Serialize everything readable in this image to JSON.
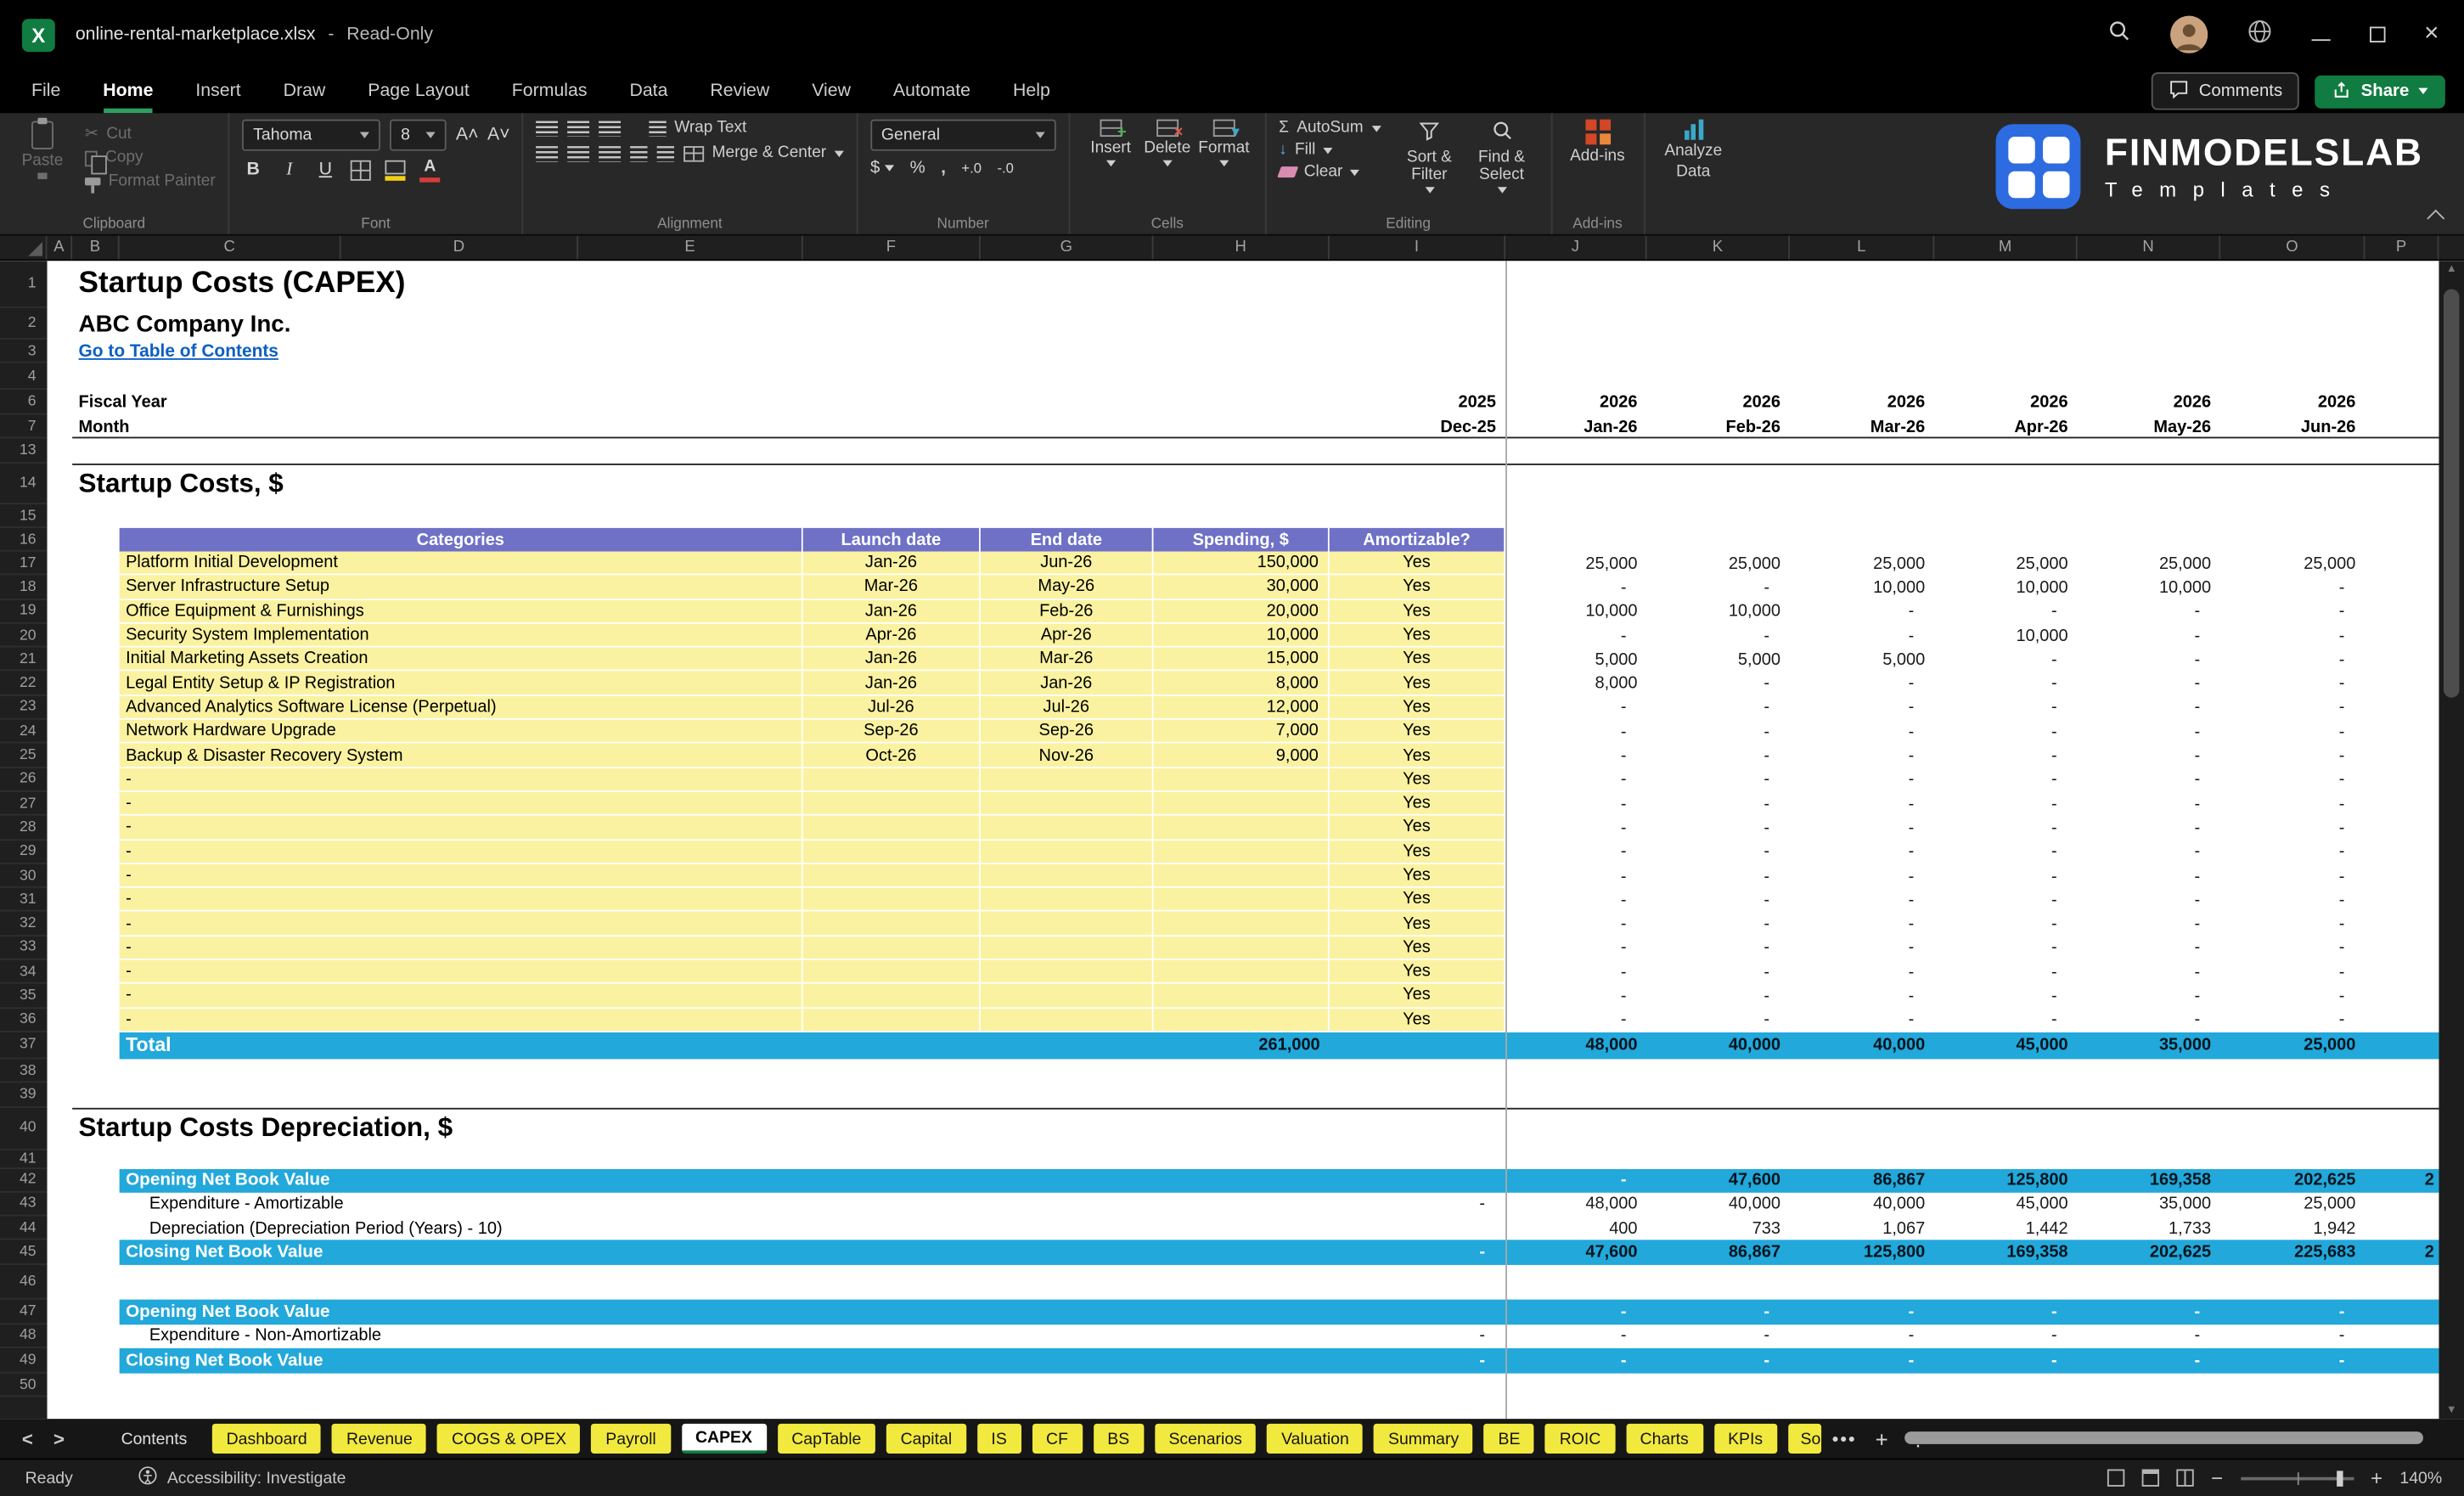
{
  "colors": {
    "accent_green": "#107C41",
    "tab_yellow": "#F2E93E",
    "cell_yellow": "#FAF2A0",
    "header_purple": "#6E71C6",
    "band_cyan": "#22A8DA",
    "link_blue": "#0D5FC3",
    "brand_blue": "#2D6BE0"
  },
  "titlebar": {
    "filename": "online-rental-marketplace.xlsx",
    "separator": "-",
    "mode": "Read-Only"
  },
  "menubar": {
    "items": [
      "File",
      "Home",
      "Insert",
      "Draw",
      "Page Layout",
      "Formulas",
      "Data",
      "Review",
      "View",
      "Automate",
      "Help"
    ],
    "active": "Home",
    "comments": "Comments",
    "share": "Share"
  },
  "ribbon": {
    "clipboard": {
      "paste": "Paste",
      "cut": "Cut",
      "copy": "Copy",
      "format_painter": "Format Painter",
      "group": "Clipboard"
    },
    "font": {
      "family": "Tahoma",
      "size": "8",
      "bold": "B",
      "italic": "I",
      "underline": "U",
      "group": "Font"
    },
    "alignment": {
      "wrap": "Wrap Text",
      "merge": "Merge & Center",
      "group": "Alignment"
    },
    "number": {
      "format": "General",
      "currency": "$",
      "percent": "%",
      "comma": ",",
      "inc_dec": "+.0",
      "dec_dec": "-.0",
      "group": "Number"
    },
    "cells": {
      "insert": "Insert",
      "delete": "Delete",
      "format": "Format",
      "group": "Cells"
    },
    "editing": {
      "autosum": "AutoSum",
      "fill": "Fill",
      "clear": "Clear",
      "sort": "Sort & Filter",
      "find": "Find & Select",
      "group": "Editing"
    },
    "addins": {
      "label": "Add-ins",
      "analyze_1": "Analyze",
      "analyze_2": "Data",
      "group": "Add-ins"
    }
  },
  "brand": {
    "name": "FINMODELSLAB",
    "tagline": "Templates"
  },
  "grid": {
    "col_letters": [
      "A",
      "B",
      "C",
      "D",
      "E",
      "F",
      "G",
      "H",
      "I",
      "J",
      "K",
      "L",
      "M",
      "N",
      "O",
      "P"
    ],
    "row_numbers": [
      1,
      2,
      3,
      4,
      6,
      7,
      13,
      14,
      15,
      16,
      17,
      18,
      19,
      20,
      21,
      22,
      23,
      24,
      25,
      26,
      27,
      28,
      29,
      30,
      31,
      32,
      33,
      34,
      35,
      36,
      37,
      38,
      39,
      40,
      41,
      42,
      43,
      44,
      45,
      46,
      47,
      48,
      49,
      50
    ]
  },
  "sheet": {
    "title": "Startup Costs (CAPEX)",
    "company": "ABC Company Inc.",
    "toc_link": "Go to Table of Contents",
    "fiscal_year_label": "Fiscal Year",
    "month_label": "Month",
    "years": [
      "2025",
      "2026",
      "2026",
      "2026",
      "2026",
      "2026",
      "2026"
    ],
    "months": [
      "Dec-25",
      "Jan-26",
      "Feb-26",
      "Mar-26",
      "Apr-26",
      "May-26",
      "Jun-26"
    ],
    "section1": "Startup Costs, $",
    "section2": "Startup Costs Depreciation, $",
    "table": {
      "headers": [
        "Categories",
        "Launch date",
        "End date",
        "Spending, $",
        "Amortizable?"
      ],
      "rows": [
        {
          "category": "Platform Initial Development",
          "launch": "Jan-26",
          "end": "Jun-26",
          "spending": "150,000",
          "amortizable": "Yes",
          "monthly": [
            "25,000",
            "25,000",
            "25,000",
            "25,000",
            "25,000",
            "25,000"
          ]
        },
        {
          "category": "Server Infrastructure Setup",
          "launch": "Mar-26",
          "end": "May-26",
          "spending": "30,000",
          "amortizable": "Yes",
          "monthly": [
            "-",
            "-",
            "10,000",
            "10,000",
            "10,000",
            "-"
          ]
        },
        {
          "category": "Office Equipment & Furnishings",
          "launch": "Jan-26",
          "end": "Feb-26",
          "spending": "20,000",
          "amortizable": "Yes",
          "monthly": [
            "10,000",
            "10,000",
            "-",
            "-",
            "-",
            "-"
          ]
        },
        {
          "category": "Security System Implementation",
          "launch": "Apr-26",
          "end": "Apr-26",
          "spending": "10,000",
          "amortizable": "Yes",
          "monthly": [
            "-",
            "-",
            "-",
            "10,000",
            "-",
            "-"
          ]
        },
        {
          "category": "Initial Marketing Assets Creation",
          "launch": "Jan-26",
          "end": "Mar-26",
          "spending": "15,000",
          "amortizable": "Yes",
          "monthly": [
            "5,000",
            "5,000",
            "5,000",
            "-",
            "-",
            "-"
          ]
        },
        {
          "category": "Legal Entity Setup & IP Registration",
          "launch": "Jan-26",
          "end": "Jan-26",
          "spending": "8,000",
          "amortizable": "Yes",
          "monthly": [
            "8,000",
            "-",
            "-",
            "-",
            "-",
            "-"
          ]
        },
        {
          "category": "Advanced Analytics Software License (Perpetual)",
          "launch": "Jul-26",
          "end": "Jul-26",
          "spending": "12,000",
          "amortizable": "Yes",
          "monthly": [
            "-",
            "-",
            "-",
            "-",
            "-",
            "-"
          ]
        },
        {
          "category": "Network Hardware Upgrade",
          "launch": "Sep-26",
          "end": "Sep-26",
          "spending": "7,000",
          "amortizable": "Yes",
          "monthly": [
            "-",
            "-",
            "-",
            "-",
            "-",
            "-"
          ]
        },
        {
          "category": "Backup & Disaster Recovery System",
          "launch": "Oct-26",
          "end": "Nov-26",
          "spending": "9,000",
          "amortizable": "Yes",
          "monthly": [
            "-",
            "-",
            "-",
            "-",
            "-",
            "-"
          ]
        },
        {
          "category": "-",
          "launch": "",
          "end": "",
          "spending": "",
          "amortizable": "Yes",
          "monthly": [
            "-",
            "-",
            "-",
            "-",
            "-",
            "-"
          ]
        },
        {
          "category": "-",
          "launch": "",
          "end": "",
          "spending": "",
          "amortizable": "Yes",
          "monthly": [
            "-",
            "-",
            "-",
            "-",
            "-",
            "-"
          ]
        },
        {
          "category": "-",
          "launch": "",
          "end": "",
          "spending": "",
          "amortizable": "Yes",
          "monthly": [
            "-",
            "-",
            "-",
            "-",
            "-",
            "-"
          ]
        },
        {
          "category": "-",
          "launch": "",
          "end": "",
          "spending": "",
          "amortizable": "Yes",
          "monthly": [
            "-",
            "-",
            "-",
            "-",
            "-",
            "-"
          ]
        },
        {
          "category": "-",
          "launch": "",
          "end": "",
          "spending": "",
          "amortizable": "Yes",
          "monthly": [
            "-",
            "-",
            "-",
            "-",
            "-",
            "-"
          ]
        },
        {
          "category": "-",
          "launch": "",
          "end": "",
          "spending": "",
          "amortizable": "Yes",
          "monthly": [
            "-",
            "-",
            "-",
            "-",
            "-",
            "-"
          ]
        },
        {
          "category": "-",
          "launch": "",
          "end": "",
          "spending": "",
          "amortizable": "Yes",
          "monthly": [
            "-",
            "-",
            "-",
            "-",
            "-",
            "-"
          ]
        },
        {
          "category": "-",
          "launch": "",
          "end": "",
          "spending": "",
          "amortizable": "Yes",
          "monthly": [
            "-",
            "-",
            "-",
            "-",
            "-",
            "-"
          ]
        },
        {
          "category": "-",
          "launch": "",
          "end": "",
          "spending": "",
          "amortizable": "Yes",
          "monthly": [
            "-",
            "-",
            "-",
            "-",
            "-",
            "-"
          ]
        },
        {
          "category": "-",
          "launch": "",
          "end": "",
          "spending": "",
          "amortizable": "Yes",
          "monthly": [
            "-",
            "-",
            "-",
            "-",
            "-",
            "-"
          ]
        },
        {
          "category": "-",
          "launch": "",
          "end": "",
          "spending": "",
          "amortizable": "Yes",
          "monthly": [
            "-",
            "-",
            "-",
            "-",
            "-",
            "-"
          ]
        }
      ],
      "total_label": "Total",
      "total_spending": "261,000",
      "total_monthly": [
        "48,000",
        "40,000",
        "40,000",
        "45,000",
        "35,000",
        "25,000"
      ]
    },
    "depreciation": {
      "rows": [
        {
          "row": 42,
          "style": "cyan",
          "label": "Opening Net Book Value",
          "i": "",
          "values": [
            "-",
            "47,600",
            "86,867",
            "125,800",
            "169,358",
            "202,625"
          ],
          "clipped": "2"
        },
        {
          "row": 43,
          "style": "plain",
          "label": "Expenditure - Amortizable",
          "i": "-",
          "values": [
            "48,000",
            "40,000",
            "40,000",
            "45,000",
            "35,000",
            "25,000"
          ],
          "clipped": ""
        },
        {
          "row": 44,
          "style": "plain",
          "label": "Depreciation (Depreciation Period (Years) - 10)",
          "i": "",
          "values": [
            "400",
            "733",
            "1,067",
            "1,442",
            "1,733",
            "1,942"
          ],
          "clipped": ""
        },
        {
          "row": 45,
          "style": "cyan",
          "label": "Closing Net Book Value",
          "i": "-",
          "values": [
            "47,600",
            "86,867",
            "125,800",
            "169,358",
            "202,625",
            "225,683"
          ],
          "clipped": "2"
        },
        {
          "row": 47,
          "style": "cyan",
          "label": "Opening Net Book Value",
          "i": "",
          "values": [
            "-",
            "-",
            "-",
            "-",
            "-",
            "-"
          ],
          "clipped": ""
        },
        {
          "row": 48,
          "style": "plain",
          "label": "Expenditure - Non-Amortizable",
          "i": "-",
          "values": [
            "-",
            "-",
            "-",
            "-",
            "-",
            "-"
          ],
          "clipped": ""
        },
        {
          "row": 49,
          "style": "cyan",
          "label": "Closing Net Book Value",
          "i": "-",
          "values": [
            "-",
            "-",
            "-",
            "-",
            "-",
            "-"
          ],
          "clipped": ""
        }
      ]
    }
  },
  "tabbar": {
    "tabs": [
      {
        "label": "Contents",
        "style": "plain"
      },
      {
        "label": "Dashboard",
        "style": "yellow"
      },
      {
        "label": "Revenue",
        "style": "yellow"
      },
      {
        "label": "COGS & OPEX",
        "style": "yellow"
      },
      {
        "label": "Payroll",
        "style": "yellow"
      },
      {
        "label": "CAPEX",
        "style": "active"
      },
      {
        "label": "CapTable",
        "style": "yellow"
      },
      {
        "label": "Capital",
        "style": "yellow"
      },
      {
        "label": "IS",
        "style": "yellow"
      },
      {
        "label": "CF",
        "style": "yellow"
      },
      {
        "label": "BS",
        "style": "yellow"
      },
      {
        "label": "Scenarios",
        "style": "yellow"
      },
      {
        "label": "Valuation",
        "style": "yellow"
      },
      {
        "label": "Summary",
        "style": "yellow"
      },
      {
        "label": "BE",
        "style": "yellow"
      },
      {
        "label": "ROIC",
        "style": "yellow"
      },
      {
        "label": "Charts",
        "style": "yellow"
      },
      {
        "label": "KPIs",
        "style": "yellow"
      },
      {
        "label": "So",
        "style": "yellow",
        "clipped": true
      }
    ]
  },
  "statusbar": {
    "ready": "Ready",
    "accessibility": "Accessibility: Investigate",
    "zoom": "140%"
  }
}
